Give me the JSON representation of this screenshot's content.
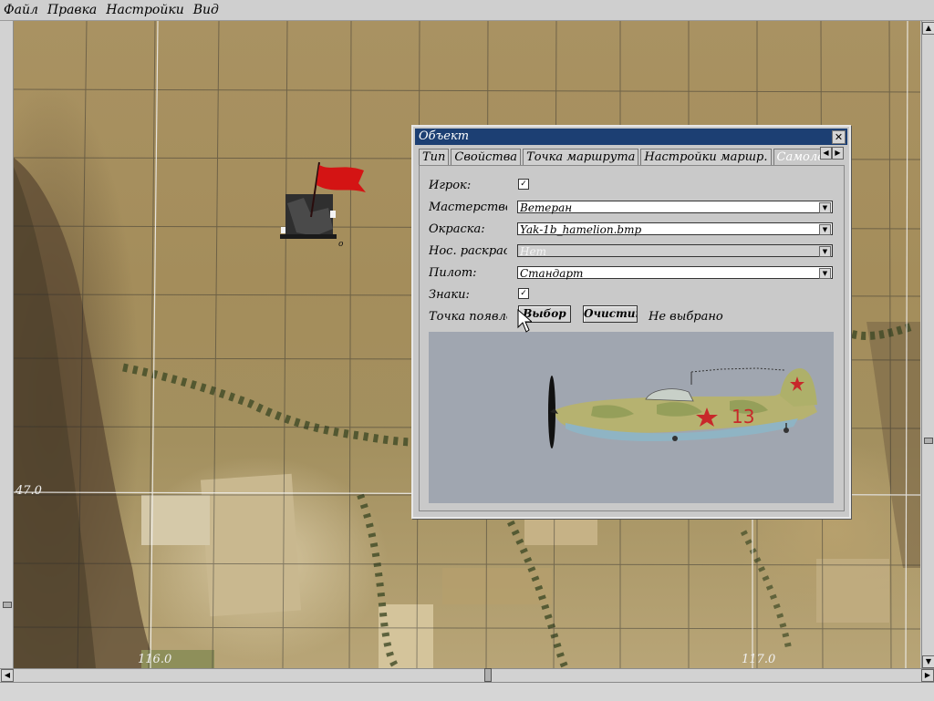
{
  "menu": [
    "Файл",
    "Правка",
    "Настройки",
    "Вид"
  ],
  "map": {
    "grid_labels": [
      "47.0",
      "116.0",
      "117.0"
    ]
  },
  "dialog": {
    "title": "Объект",
    "close_icon": "close-icon",
    "tabs": [
      "Тип",
      "Свойства",
      "Точка маршрута",
      "Настройки маршр.",
      "Самолет"
    ],
    "active_tab": "Самолет",
    "fields": {
      "player_label": "Игрок:",
      "player_checked": true,
      "skill_label": "Мастерство:",
      "skill_value": "Ветеран",
      "paint_label": "Окраска:",
      "paint_value": "Yak-1b_hamelion.bmp",
      "nose_label": "Нос. раскраска:",
      "nose_value": "Нет",
      "pilot_label": "Пилот:",
      "pilot_value": "Стандарт",
      "markings_label": "Знаки:",
      "markings_checked": true,
      "spawn_label": "Точка появления:",
      "select_button": "Выбор",
      "clear_button": "Очистить",
      "spawn_status": "Не выбрано"
    },
    "preview": {
      "tail_number": "13"
    }
  },
  "colors": {
    "titlebar": "#1c3f73",
    "flag": "#d41414",
    "map_base": "#a99262"
  }
}
